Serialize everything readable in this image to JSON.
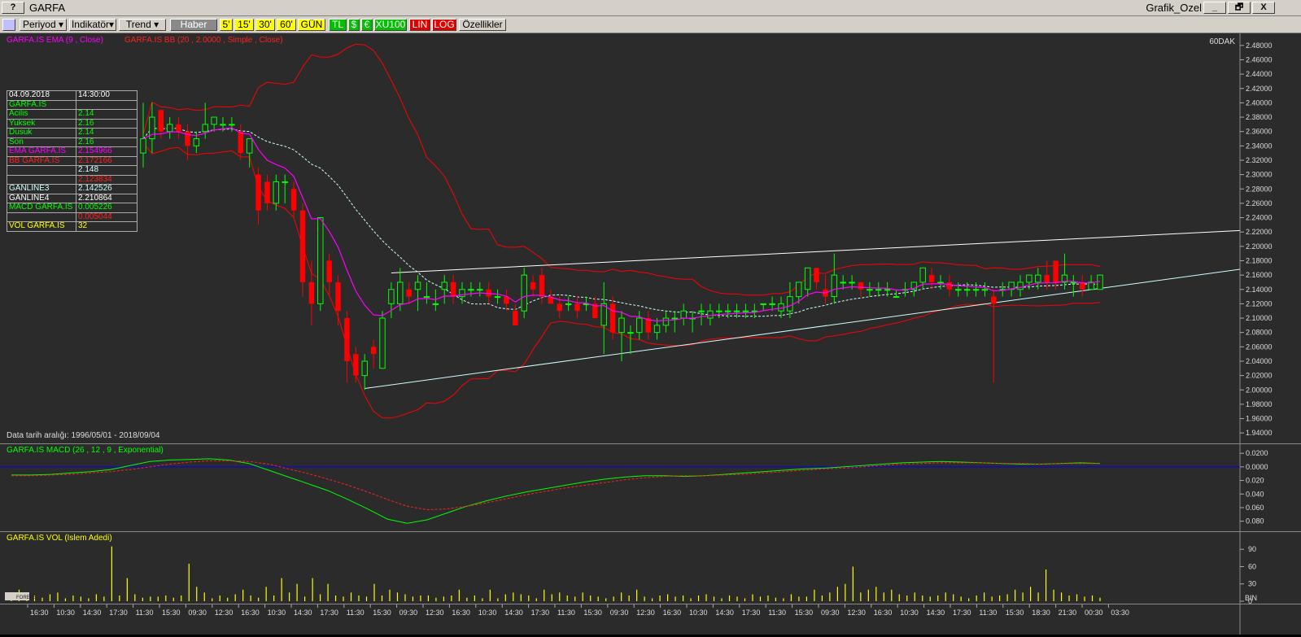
{
  "window": {
    "help_button": "?",
    "symbol": "GARFA",
    "title": "Grafik_Ozel",
    "minimize": "_",
    "restore": "🗗",
    "close": "X"
  },
  "toolbar": {
    "period": "Periyod",
    "indicators": "İndikatör",
    "trend": "Trend",
    "news": "Haber",
    "p5": "5'",
    "p15": "15'",
    "p30": "30'",
    "p60": "60'",
    "gun": "GÜN",
    "tl": "TL",
    "usd": "$",
    "eur": "€",
    "xu100": "XU100",
    "lin": "LIN",
    "log": "LOG",
    "properties": "Özellikler"
  },
  "main_panel": {
    "legend_ema": "GARFA.IS EMA (9 , Close)",
    "legend_bb": "GARFA.IS BB (20 , 2.0000 , Simple , Close)",
    "interval": "60DAK",
    "date_range": "Data tarih aralığı: 1996/05/01 - 2018/09/04",
    "y_ticks": [
      "2.48000",
      "2.46000",
      "2.44000",
      "2.42000",
      "2.40000",
      "2.38000",
      "2.36000",
      "2.34000",
      "2.32000",
      "2.30000",
      "2.28000",
      "2.26000",
      "2.24000",
      "2.22000",
      "2.20000",
      "2.18000",
      "2.16000",
      "2.14000",
      "2.12000",
      "2.10000",
      "2.08000",
      "2.06000",
      "2.04000",
      "2.02000",
      "2.00000",
      "1.98000",
      "1.96000",
      "1.94000"
    ]
  },
  "info_table": {
    "date": "04.09.2018",
    "time": "14:30:00",
    "symbol": "GARFA.IS",
    "rows": [
      {
        "label": "Acilis",
        "value": "2.14",
        "color": "#00ff00"
      },
      {
        "label": "Yuksek",
        "value": "2.16",
        "color": "#00ff00"
      },
      {
        "label": "Dusuk",
        "value": "2.14",
        "color": "#00ff00"
      },
      {
        "label": "Son",
        "value": "2.16",
        "color": "#00ff00"
      },
      {
        "label": "EMA GARFA.IS",
        "value": "2.154966",
        "color": "#ff00ff"
      },
      {
        "label": "BB GARFA.IS",
        "value": "2.172166",
        "color": "#ff2020"
      },
      {
        "label": "",
        "value": "2.148",
        "color": "#cfffff"
      },
      {
        "label": "",
        "value": "2.123834",
        "color": "#ff2020"
      },
      {
        "label": "GANLINE3",
        "value": "2.142526",
        "color": "#cfffff"
      },
      {
        "label": "GANLINE4",
        "value": "2.210864",
        "color": "#ffffff"
      },
      {
        "label": "MACD GARFA.IS",
        "value": "0.005226",
        "color": "#00ff00"
      },
      {
        "label": "",
        "value": "0.005044",
        "color": "#ff2020"
      },
      {
        "label": "VOL GARFA.IS",
        "value": "32",
        "color": "#ffff00"
      }
    ]
  },
  "macd_panel": {
    "legend": "GARFA.IS MACD (26 , 12 , 9 , Exponential)",
    "y_ticks": [
      "0.0200",
      "0.0000",
      "0.020",
      "0.040",
      "0.060",
      "0.080"
    ]
  },
  "vol_panel": {
    "legend": "GARFA.IS VOL (Islem Adedi)",
    "y_ticks": [
      "90",
      "60",
      "30",
      "0"
    ],
    "bin_label": "BIN",
    "logo": "FOREKS"
  },
  "x_ticks": [
    "16:30",
    "10:30",
    "14:30",
    "17:30",
    "11:30",
    "15:30",
    "09:30",
    "12:30",
    "16:30",
    "10:30",
    "14:30",
    "17:30",
    "11:30",
    "15:30",
    "09:30",
    "12:30",
    "16:30",
    "10:30",
    "14:30",
    "17:30",
    "11:30",
    "15:30",
    "09:30",
    "12:30",
    "16:30",
    "10:30",
    "14:30",
    "17:30",
    "11:30",
    "15:30",
    "09:30",
    "12:30",
    "16:30",
    "10:30",
    "14:30",
    "17:30",
    "11:30",
    "15:30",
    "18:30",
    "21:30",
    "00:30",
    "03:30"
  ],
  "colors": {
    "background": "#2b2b2b",
    "up": "#00ff00",
    "down": "#ff0000",
    "ema": "#ff00ff",
    "bollinger": "#ff0000",
    "bb_mid": "#cfffff",
    "volume": "#ffff00",
    "macd": "#00ff00",
    "signal": "#ff2020",
    "zero_line": "#0000ff"
  },
  "chart_data": [
    {
      "type": "candlestick",
      "title": "GARFA.IS",
      "ylim": [
        1.93,
        2.49
      ],
      "candles": [
        {
          "o": 2.33,
          "h": 2.4,
          "l": 2.31,
          "c": 2.35
        },
        {
          "o": 2.35,
          "h": 2.4,
          "l": 2.33,
          "c": 2.38
        },
        {
          "o": 2.39,
          "h": 2.39,
          "l": 2.35,
          "c": 2.36
        },
        {
          "o": 2.36,
          "h": 2.38,
          "l": 2.35,
          "c": 2.37
        },
        {
          "o": 2.37,
          "h": 2.38,
          "l": 2.35,
          "c": 2.36
        },
        {
          "o": 2.36,
          "h": 2.37,
          "l": 2.32,
          "c": 2.34
        },
        {
          "o": 2.34,
          "h": 2.36,
          "l": 2.33,
          "c": 2.35
        },
        {
          "o": 2.36,
          "h": 2.4,
          "l": 2.35,
          "c": 2.37
        },
        {
          "o": 2.37,
          "h": 2.38,
          "l": 2.36,
          "c": 2.38
        },
        {
          "o": 2.37,
          "h": 2.38,
          "l": 2.36,
          "c": 2.37
        },
        {
          "o": 2.37,
          "h": 2.38,
          "l": 2.36,
          "c": 2.37
        },
        {
          "o": 2.36,
          "h": 2.37,
          "l": 2.32,
          "c": 2.33
        },
        {
          "o": 2.33,
          "h": 2.35,
          "l": 2.31,
          "c": 2.35
        },
        {
          "o": 2.3,
          "h": 2.31,
          "l": 2.23,
          "c": 2.25
        },
        {
          "o": 2.29,
          "h": 2.3,
          "l": 2.25,
          "c": 2.26
        },
        {
          "o": 2.26,
          "h": 2.3,
          "l": 2.25,
          "c": 2.29
        },
        {
          "o": 2.29,
          "h": 2.3,
          "l": 2.26,
          "c": 2.29
        },
        {
          "o": 2.28,
          "h": 2.29,
          "l": 2.24,
          "c": 2.25
        },
        {
          "o": 2.25,
          "h": 2.26,
          "l": 2.13,
          "c": 2.15
        },
        {
          "o": 2.15,
          "h": 2.18,
          "l": 2.09,
          "c": 2.12
        },
        {
          "o": 2.12,
          "h": 2.24,
          "l": 2.11,
          "c": 2.24
        },
        {
          "o": 2.18,
          "h": 2.19,
          "l": 2.13,
          "c": 2.15
        },
        {
          "o": 2.15,
          "h": 2.16,
          "l": 2.09,
          "c": 2.11
        },
        {
          "o": 2.1,
          "h": 2.11,
          "l": 2.01,
          "c": 2.04
        },
        {
          "o": 2.05,
          "h": 2.06,
          "l": 2.01,
          "c": 2.02
        },
        {
          "o": 2.02,
          "h": 2.05,
          "l": 2.0,
          "c": 2.04
        },
        {
          "o": 2.06,
          "h": 2.07,
          "l": 2.03,
          "c": 2.05
        },
        {
          "o": 2.03,
          "h": 2.11,
          "l": 2.03,
          "c": 2.1
        },
        {
          "o": 2.12,
          "h": 2.15,
          "l": 2.1,
          "c": 2.14
        },
        {
          "o": 2.12,
          "h": 2.17,
          "l": 2.11,
          "c": 2.15
        },
        {
          "o": 2.14,
          "h": 2.15,
          "l": 2.12,
          "c": 2.13
        },
        {
          "o": 2.14,
          "h": 2.16,
          "l": 2.11,
          "c": 2.15
        },
        {
          "o": 2.13,
          "h": 2.15,
          "l": 2.12,
          "c": 2.13
        },
        {
          "o": 2.12,
          "h": 2.14,
          "l": 2.11,
          "c": 2.12
        },
        {
          "o": 2.14,
          "h": 2.16,
          "l": 2.12,
          "c": 2.15
        },
        {
          "o": 2.15,
          "h": 2.16,
          "l": 2.12,
          "c": 2.13
        },
        {
          "o": 2.13,
          "h": 2.15,
          "l": 2.12,
          "c": 2.14
        },
        {
          "o": 2.14,
          "h": 2.15,
          "l": 2.13,
          "c": 2.14
        },
        {
          "o": 2.14,
          "h": 2.15,
          "l": 2.13,
          "c": 2.14
        },
        {
          "o": 2.14,
          "h": 2.15,
          "l": 2.12,
          "c": 2.13
        },
        {
          "o": 2.13,
          "h": 2.14,
          "l": 2.12,
          "c": 2.13
        },
        {
          "o": 2.13,
          "h": 2.14,
          "l": 2.11,
          "c": 2.12
        },
        {
          "o": 2.11,
          "h": 2.12,
          "l": 2.09,
          "c": 2.09
        },
        {
          "o": 2.11,
          "h": 2.17,
          "l": 2.1,
          "c": 2.16
        },
        {
          "o": 2.15,
          "h": 2.16,
          "l": 2.13,
          "c": 2.14
        },
        {
          "o": 2.16,
          "h": 2.17,
          "l": 2.12,
          "c": 2.13
        },
        {
          "o": 2.13,
          "h": 2.14,
          "l": 2.12,
          "c": 2.12
        },
        {
          "o": 2.12,
          "h": 2.13,
          "l": 2.1,
          "c": 2.11
        },
        {
          "o": 2.12,
          "h": 2.13,
          "l": 2.11,
          "c": 2.12
        },
        {
          "o": 2.12,
          "h": 2.13,
          "l": 2.1,
          "c": 2.11
        },
        {
          "o": 2.12,
          "h": 2.13,
          "l": 2.11,
          "c": 2.12
        },
        {
          "o": 2.12,
          "h": 2.13,
          "l": 2.1,
          "c": 2.1
        },
        {
          "o": 2.09,
          "h": 2.15,
          "l": 2.05,
          "c": 2.12
        },
        {
          "o": 2.12,
          "h": 2.13,
          "l": 2.07,
          "c": 2.08
        },
        {
          "o": 2.08,
          "h": 2.11,
          "l": 2.04,
          "c": 2.1
        },
        {
          "o": 2.08,
          "h": 2.09,
          "l": 2.05,
          "c": 2.08
        },
        {
          "o": 2.08,
          "h": 2.11,
          "l": 2.07,
          "c": 2.1
        },
        {
          "o": 2.1,
          "h": 2.11,
          "l": 2.07,
          "c": 2.08
        },
        {
          "o": 2.08,
          "h": 2.1,
          "l": 2.07,
          "c": 2.09
        },
        {
          "o": 2.09,
          "h": 2.11,
          "l": 2.08,
          "c": 2.1
        },
        {
          "o": 2.1,
          "h": 2.11,
          "l": 2.08,
          "c": 2.1
        },
        {
          "o": 2.1,
          "h": 2.12,
          "l": 2.09,
          "c": 2.11
        },
        {
          "o": 2.1,
          "h": 2.11,
          "l": 2.08,
          "c": 2.1
        },
        {
          "o": 2.11,
          "h": 2.12,
          "l": 2.09,
          "c": 2.11
        },
        {
          "o": 2.1,
          "h": 2.12,
          "l": 2.09,
          "c": 2.11
        },
        {
          "o": 2.11,
          "h": 2.12,
          "l": 2.1,
          "c": 2.11
        },
        {
          "o": 2.11,
          "h": 2.12,
          "l": 2.1,
          "c": 2.11
        },
        {
          "o": 2.11,
          "h": 2.12,
          "l": 2.1,
          "c": 2.11
        },
        {
          "o": 2.11,
          "h": 2.12,
          "l": 2.1,
          "c": 2.11
        },
        {
          "o": 2.11,
          "h": 2.12,
          "l": 2.1,
          "c": 2.11
        },
        {
          "o": 2.12,
          "h": 2.12,
          "l": 2.11,
          "c": 2.12
        },
        {
          "o": 2.12,
          "h": 2.13,
          "l": 2.11,
          "c": 2.12
        },
        {
          "o": 2.11,
          "h": 2.13,
          "l": 2.1,
          "c": 2.12
        },
        {
          "o": 2.11,
          "h": 2.15,
          "l": 2.1,
          "c": 2.13
        },
        {
          "o": 2.13,
          "h": 2.15,
          "l": 2.12,
          "c": 2.15
        },
        {
          "o": 2.14,
          "h": 2.17,
          "l": 2.13,
          "c": 2.17
        },
        {
          "o": 2.17,
          "h": 2.17,
          "l": 2.14,
          "c": 2.15
        },
        {
          "o": 2.14,
          "h": 2.16,
          "l": 2.12,
          "c": 2.13
        },
        {
          "o": 2.13,
          "h": 2.19,
          "l": 2.12,
          "c": 2.16
        },
        {
          "o": 2.15,
          "h": 2.16,
          "l": 2.14,
          "c": 2.15
        },
        {
          "o": 2.15,
          "h": 2.16,
          "l": 2.14,
          "c": 2.15
        },
        {
          "o": 2.15,
          "h": 2.15,
          "l": 2.13,
          "c": 2.14
        },
        {
          "o": 2.14,
          "h": 2.15,
          "l": 2.13,
          "c": 2.14
        },
        {
          "o": 2.14,
          "h": 2.15,
          "l": 2.13,
          "c": 2.14
        },
        {
          "o": 2.14,
          "h": 2.15,
          "l": 2.13,
          "c": 2.14
        },
        {
          "o": 2.13,
          "h": 2.14,
          "l": 2.13,
          "c": 2.13
        },
        {
          "o": 2.14,
          "h": 2.15,
          "l": 2.13,
          "c": 2.14
        },
        {
          "o": 2.14,
          "h": 2.15,
          "l": 2.13,
          "c": 2.15
        },
        {
          "o": 2.15,
          "h": 2.17,
          "l": 2.14,
          "c": 2.17
        },
        {
          "o": 2.16,
          "h": 2.17,
          "l": 2.14,
          "c": 2.15
        },
        {
          "o": 2.15,
          "h": 2.16,
          "l": 2.14,
          "c": 2.15
        },
        {
          "o": 2.15,
          "h": 2.16,
          "l": 2.13,
          "c": 2.14
        },
        {
          "o": 2.14,
          "h": 2.15,
          "l": 2.13,
          "c": 2.14
        },
        {
          "o": 2.14,
          "h": 2.15,
          "l": 2.13,
          "c": 2.14
        },
        {
          "o": 2.14,
          "h": 2.15,
          "l": 2.13,
          "c": 2.14
        },
        {
          "o": 2.14,
          "h": 2.15,
          "l": 2.13,
          "c": 2.14
        },
        {
          "o": 2.13,
          "h": 2.14,
          "l": 2.01,
          "c": 2.12
        },
        {
          "o": 2.14,
          "h": 2.15,
          "l": 2.13,
          "c": 2.14
        },
        {
          "o": 2.14,
          "h": 2.15,
          "l": 2.13,
          "c": 2.15
        },
        {
          "o": 2.14,
          "h": 2.16,
          "l": 2.13,
          "c": 2.15
        },
        {
          "o": 2.15,
          "h": 2.16,
          "l": 2.14,
          "c": 2.16
        },
        {
          "o": 2.15,
          "h": 2.17,
          "l": 2.14,
          "c": 2.16
        },
        {
          "o": 2.16,
          "h": 2.18,
          "l": 2.14,
          "c": 2.15
        },
        {
          "o": 2.18,
          "h": 2.18,
          "l": 2.14,
          "c": 2.15
        },
        {
          "o": 2.15,
          "h": 2.19,
          "l": 2.14,
          "c": 2.16
        },
        {
          "o": 2.15,
          "h": 2.16,
          "l": 2.13,
          "c": 2.15
        },
        {
          "o": 2.15,
          "h": 2.16,
          "l": 2.13,
          "c": 2.14
        },
        {
          "o": 2.14,
          "h": 2.16,
          "l": 2.14,
          "c": 2.15
        },
        {
          "o": 2.14,
          "h": 2.16,
          "l": 2.14,
          "c": 2.16
        }
      ]
    },
    {
      "type": "line",
      "title": "GARFA.IS MACD (26 , 12 , 9 , Exponential)",
      "ylim": [
        -0.09,
        0.025
      ],
      "series": [
        {
          "name": "MACD",
          "values": [
            -0.012,
            -0.012,
            -0.011,
            -0.009,
            -0.007,
            -0.004,
            0.002,
            0.008,
            0.01,
            0.011,
            0.012,
            0.01,
            0.005,
            -0.005,
            -0.015,
            -0.025,
            -0.035,
            -0.048,
            -0.062,
            -0.077,
            -0.083,
            -0.078,
            -0.068,
            -0.058,
            -0.05,
            -0.043,
            -0.037,
            -0.032,
            -0.027,
            -0.022,
            -0.018,
            -0.015,
            -0.013,
            -0.013,
            -0.014,
            -0.013,
            -0.011,
            -0.009,
            -0.007,
            -0.005,
            -0.003,
            -0.002,
            0.0,
            0.002,
            0.004,
            0.006,
            0.007,
            0.008,
            0.007,
            0.006,
            0.005,
            0.004,
            0.004,
            0.005,
            0.006,
            0.005
          ]
        },
        {
          "name": "Signal",
          "values": [
            -0.013,
            -0.013,
            -0.012,
            -0.011,
            -0.009,
            -0.007,
            -0.004,
            0.0,
            0.004,
            0.007,
            0.009,
            0.009,
            0.008,
            0.004,
            -0.003,
            -0.01,
            -0.018,
            -0.027,
            -0.037,
            -0.048,
            -0.058,
            -0.063,
            -0.062,
            -0.058,
            -0.053,
            -0.047,
            -0.041,
            -0.036,
            -0.031,
            -0.027,
            -0.023,
            -0.019,
            -0.016,
            -0.014,
            -0.013,
            -0.013,
            -0.012,
            -0.011,
            -0.009,
            -0.007,
            -0.005,
            -0.003,
            -0.002,
            0.0,
            0.002,
            0.004,
            0.005,
            0.006,
            0.006,
            0.006,
            0.005,
            0.005,
            0.004,
            0.005,
            0.005,
            0.005
          ]
        }
      ]
    },
    {
      "type": "bar",
      "title": "GARFA.IS VOL (Islem Adedi)",
      "ylim": [
        0,
        110
      ],
      "values": [
        8,
        20,
        5,
        10,
        6,
        12,
        15,
        5,
        10,
        8,
        5,
        12,
        8,
        95,
        10,
        40,
        12,
        6,
        8,
        8,
        10,
        6,
        10,
        65,
        25,
        15,
        5,
        10,
        6,
        12,
        20,
        10,
        6,
        25,
        10,
        40,
        15,
        30,
        8,
        40,
        12,
        30,
        10,
        8,
        15,
        10,
        8,
        30,
        10,
        20,
        15,
        12,
        8,
        10,
        10,
        6,
        8,
        10,
        20,
        6,
        10,
        5,
        20,
        5,
        12,
        15,
        12,
        10,
        5,
        20,
        12,
        15,
        10,
        8,
        15,
        10,
        8,
        5,
        8,
        15,
        10,
        20,
        8,
        5,
        10,
        12,
        8,
        10,
        5,
        10,
        12,
        8,
        5,
        10,
        8,
        5,
        12,
        8,
        10,
        6,
        5,
        12,
        8,
        8,
        20,
        10,
        15,
        25,
        30,
        60,
        15,
        20,
        25,
        15,
        20,
        12,
        10,
        15,
        10,
        8,
        10,
        15,
        12,
        8,
        5,
        10,
        15,
        8,
        10,
        12,
        20,
        15,
        25,
        15,
        55,
        20,
        15,
        10,
        12,
        8,
        10,
        6
      ]
    }
  ]
}
